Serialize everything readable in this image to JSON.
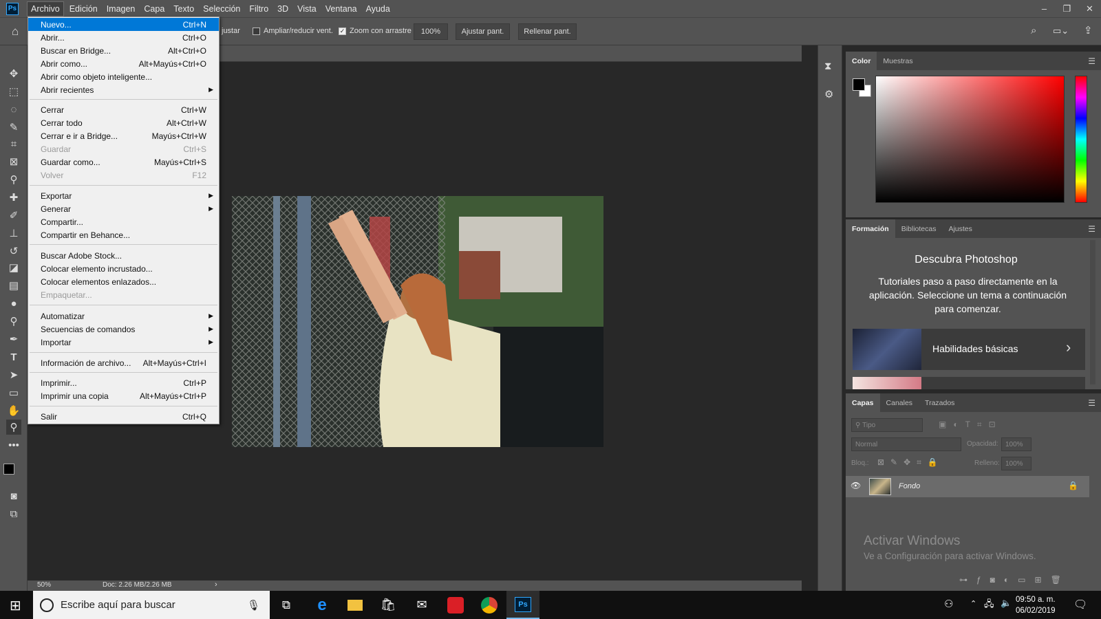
{
  "menubar": {
    "logo": "Ps",
    "items": [
      "Archivo",
      "Edición",
      "Imagen",
      "Capa",
      "Texto",
      "Selección",
      "Filtro",
      "3D",
      "Vista",
      "Ventana",
      "Ayuda"
    ]
  },
  "window_controls": {
    "minimize": "–",
    "restore": "❐",
    "close": "✕"
  },
  "options_bar": {
    "partial_label": "justar",
    "resize_windows_label": "Ampliar/reducir vent.",
    "resize_windows_checked": false,
    "scrubby_zoom_label": "Zoom con arrastre",
    "scrubby_zoom_checked": true,
    "zoom_100": "100%",
    "fit_screen": "Ajustar pant.",
    "fill_screen": "Rellenar pant."
  },
  "archivo_menu": [
    {
      "label": "Nuevo...",
      "shortcut": "Ctrl+N",
      "highlighted": true
    },
    {
      "label": "Abrir...",
      "shortcut": "Ctrl+O"
    },
    {
      "label": "Buscar en Bridge...",
      "shortcut": "Alt+Ctrl+O"
    },
    {
      "label": "Abrir como...",
      "shortcut": "Alt+Mayús+Ctrl+O"
    },
    {
      "label": "Abrir como objeto inteligente...",
      "shortcut": ""
    },
    {
      "label": "Abrir recientes",
      "shortcut": "",
      "submenu": true
    },
    {
      "separator": true
    },
    {
      "label": "Cerrar",
      "shortcut": "Ctrl+W"
    },
    {
      "label": "Cerrar todo",
      "shortcut": "Alt+Ctrl+W"
    },
    {
      "label": "Cerrar e ir a Bridge...",
      "shortcut": "Mayús+Ctrl+W"
    },
    {
      "label": "Guardar",
      "shortcut": "Ctrl+S",
      "disabled": true
    },
    {
      "label": "Guardar como...",
      "shortcut": "Mayús+Ctrl+S"
    },
    {
      "label": "Volver",
      "shortcut": "F12",
      "disabled": true
    },
    {
      "separator": true
    },
    {
      "label": "Exportar",
      "shortcut": "",
      "submenu": true
    },
    {
      "label": "Generar",
      "shortcut": "",
      "submenu": true
    },
    {
      "label": "Compartir...",
      "shortcut": ""
    },
    {
      "label": "Compartir en Behance...",
      "shortcut": ""
    },
    {
      "separator": true
    },
    {
      "label": "Buscar Adobe Stock...",
      "shortcut": ""
    },
    {
      "label": "Colocar elemento incrustado...",
      "shortcut": ""
    },
    {
      "label": "Colocar elementos enlazados...",
      "shortcut": ""
    },
    {
      "label": "Empaquetar...",
      "shortcut": "",
      "disabled": true
    },
    {
      "separator": true
    },
    {
      "label": "Automatizar",
      "shortcut": "",
      "submenu": true
    },
    {
      "label": "Secuencias de comandos",
      "shortcut": "",
      "submenu": true
    },
    {
      "label": "Importar",
      "shortcut": "",
      "submenu": true
    },
    {
      "separator": true
    },
    {
      "label": "Información de archivo...",
      "shortcut": "Alt+Mayús+Ctrl+I"
    },
    {
      "separator": true
    },
    {
      "label": "Imprimir...",
      "shortcut": "Ctrl+P"
    },
    {
      "label": "Imprimir una copia",
      "shortcut": "Alt+Mayús+Ctrl+P"
    },
    {
      "separator": true
    },
    {
      "label": "Salir",
      "shortcut": "Ctrl+Q"
    }
  ],
  "status_bar": {
    "zoom": "50%",
    "doc": "Doc: 2.26 MB/2.26 MB",
    "arrow": "›"
  },
  "color_panel": {
    "tabs": [
      "Color",
      "Muestras"
    ],
    "active": 0,
    "foreground": "#000000",
    "background": "#ffffff"
  },
  "learn_panel": {
    "tabs": [
      "Formación",
      "Bibliotecas",
      "Ajustes"
    ],
    "active": 0,
    "title": "Descubra Photoshop",
    "description": "Tutoriales paso a paso directamente en la aplicación. Seleccione un tema a continuación para comenzar.",
    "card_title": "Habilidades básicas",
    "card_arrow": "›"
  },
  "layers_panel": {
    "tabs": [
      "Capas",
      "Canales",
      "Trazados"
    ],
    "active": 0,
    "filter_placeholder": "Tipo",
    "blend_mode": "Normal",
    "opacity_label": "Opacidad:",
    "opacity_value": "100%",
    "lock_label": "Bloq.:",
    "fill_label": "Relleno:",
    "fill_value": "100%",
    "layers": [
      {
        "name": "Fondo",
        "visible": true,
        "locked": true
      }
    ]
  },
  "watermark": {
    "title": "Activar Windows",
    "subtitle": "Ve a Configuración para activar Windows."
  },
  "taskbar": {
    "search_placeholder": "Escribe aquí para buscar",
    "time": "09:50 a. m.",
    "date": "06/02/2019",
    "ps_label": "Ps"
  },
  "colors": {
    "ui_gray": "#535353",
    "canvas": "#282828",
    "highlight": "#0078d7",
    "ps_blue": "#31a8ff"
  }
}
